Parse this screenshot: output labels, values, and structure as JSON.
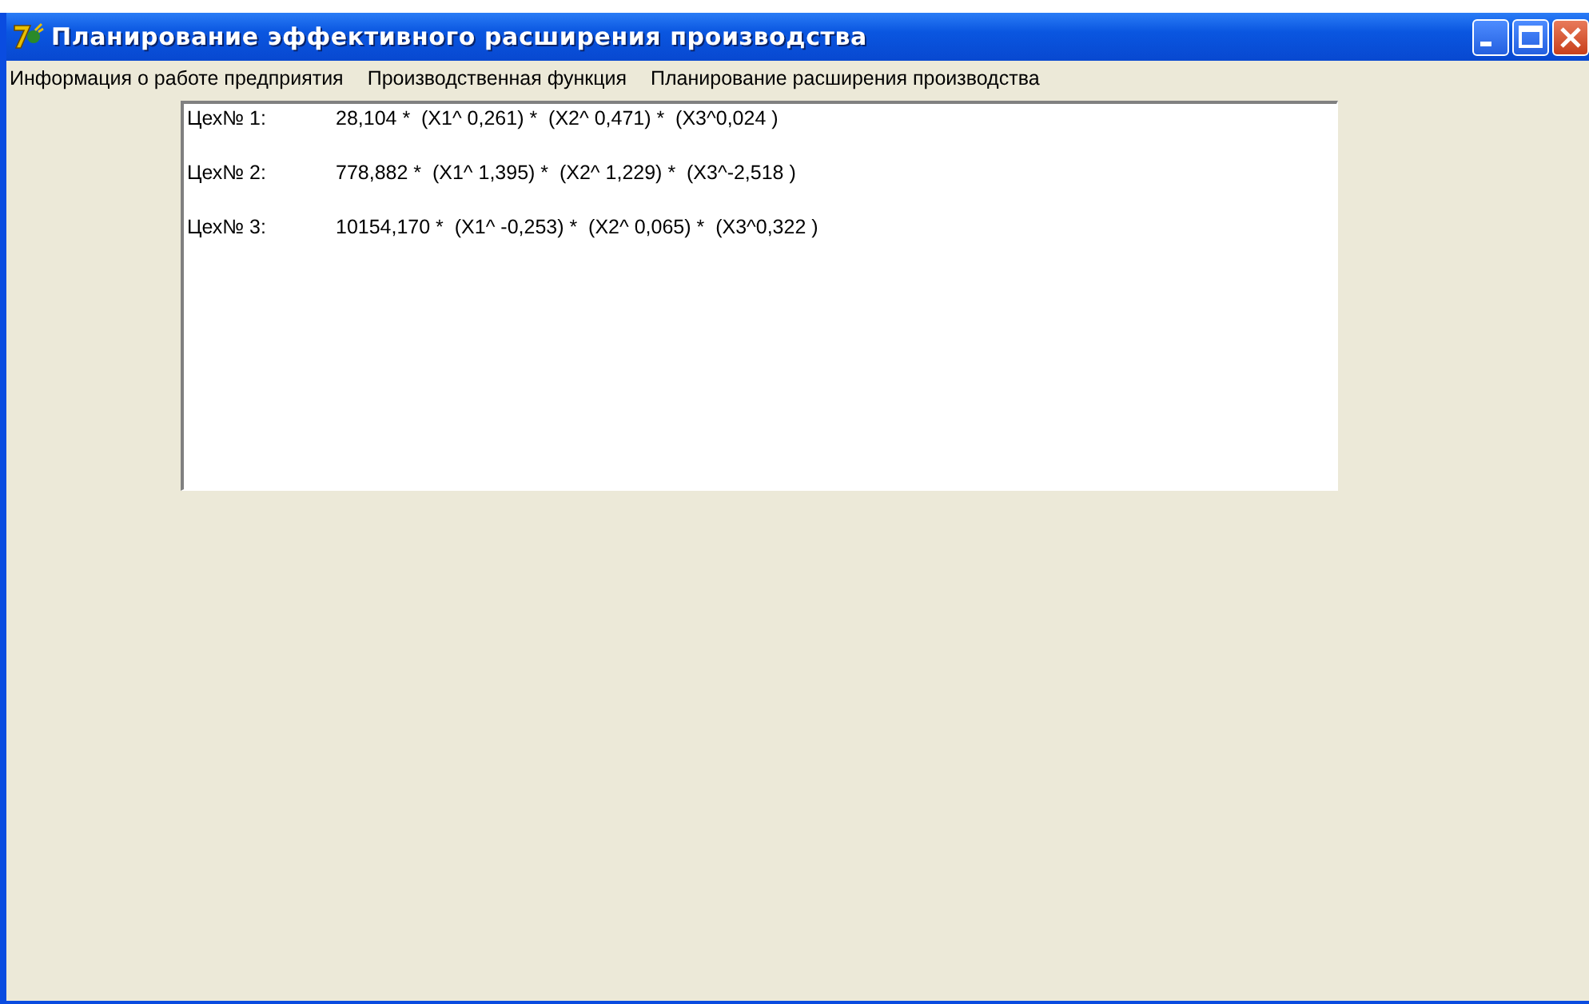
{
  "window": {
    "title": "Планирование эффективного расширения производства"
  },
  "menu": [
    "Информация о работе предприятия",
    "Производственная функция",
    "Планирование расширения производства"
  ],
  "lines": [
    {
      "label": "Цех№ 1:",
      "formula": "28,104 *  (X1^ 0,261) *  (X2^ 0,471) *  (X3^0,024 )"
    },
    {
      "label": "Цех№ 2:",
      "formula": "778,882 *  (X1^ 1,395) *  (X2^ 1,229) *  (X3^-2,518 )"
    },
    {
      "label": "Цех№ 3:",
      "formula": "10154,170 *  (X1^ -0,253) *  (X2^ 0,065) *  (X3^0,322 )"
    }
  ]
}
